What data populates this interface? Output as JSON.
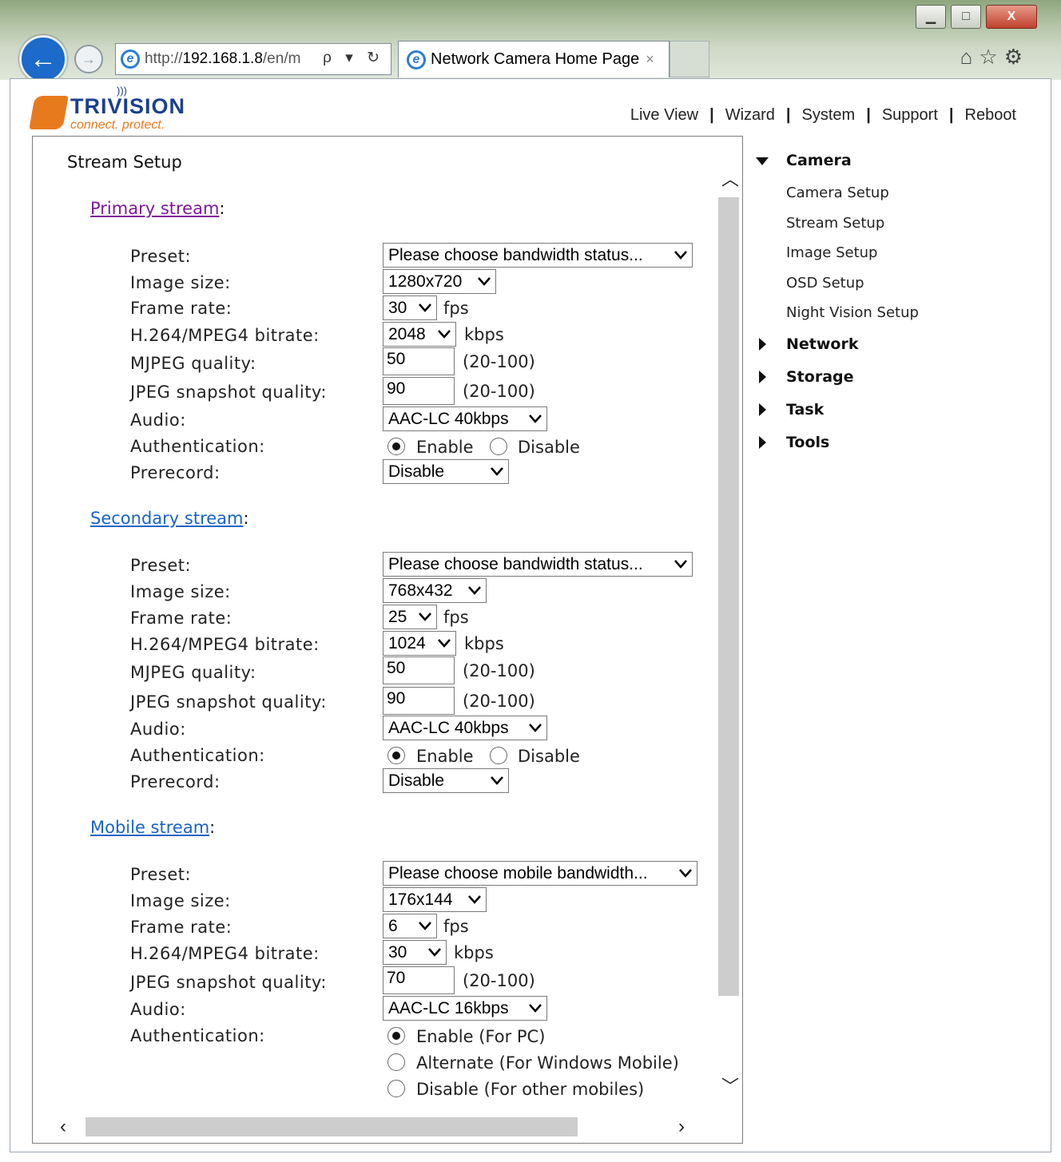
{
  "browser": {
    "url_prefix": "http://",
    "url_host": "192.168.1.8",
    "url_path": "/en/m",
    "url_tools": "ρ ▾ ↻",
    "tab_title": "Network Camera Home Page",
    "tab_close": "×",
    "min": "▁",
    "max": "□",
    "close": "X"
  },
  "brand": {
    "name": "TRIVISION",
    "tagline": "connect. protect."
  },
  "nav": {
    "live_view": "Live View",
    "wizard": "Wizard",
    "system": "System",
    "support": "Support",
    "reboot": "Reboot",
    "sep": "|"
  },
  "page": {
    "title": "Stream Setup"
  },
  "labels": {
    "preset": "Preset:",
    "image_size": "Image size:",
    "frame_rate": "Frame rate:",
    "bitrate": "H.264/MPEG4 bitrate:",
    "mjpeg_quality": "MJPEG quality:",
    "jpeg_quality": "JPEG snapshot quality:",
    "audio": "Audio:",
    "authentication": "Authentication:",
    "prerecord": "Prerecord:",
    "fps": "fps",
    "kbps": "kbps",
    "range": "(20-100)",
    "enable": "Enable",
    "disable": "Disable",
    "colon": ":"
  },
  "primary": {
    "title": "Primary stream",
    "preset": "Please choose bandwidth status...",
    "image_size": "1280x720",
    "frame_rate": "30",
    "bitrate": "2048",
    "mjpeg_quality": "50",
    "jpeg_quality": "90",
    "audio": "AAC-LC 40kbps",
    "auth": "Enable",
    "prerecord": "Disable"
  },
  "secondary": {
    "title": "Secondary stream",
    "preset": "Please choose bandwidth status...",
    "image_size": "768x432",
    "frame_rate": "25",
    "bitrate": "1024",
    "mjpeg_quality": "50",
    "jpeg_quality": "90",
    "audio": "AAC-LC 40kbps",
    "auth": "Enable",
    "prerecord": "Disable"
  },
  "mobile": {
    "title": "Mobile stream",
    "preset": "Please choose mobile bandwidth...",
    "image_size": "176x144",
    "frame_rate": "6",
    "bitrate": "30",
    "jpeg_quality": "70",
    "audio": "AAC-LC 16kbps",
    "auth_enable": "Enable (For PC)",
    "auth_alternate": "Alternate (For Windows Mobile)",
    "auth_disable": "Disable (For other mobiles)",
    "auth": "Enable (For PC)"
  },
  "sidebar": {
    "camera": "Camera",
    "camera_items": [
      "Camera Setup",
      "Stream Setup",
      "Image Setup",
      "OSD Setup",
      "Night Vision Setup"
    ],
    "network": "Network",
    "storage": "Storage",
    "task": "Task",
    "tools": "Tools"
  },
  "colors": {
    "link": "#1a63c8",
    "visited_link": "#7c1a9a",
    "brand_orange": "#e87a1e",
    "brand_blue": "#1b3f8f"
  }
}
